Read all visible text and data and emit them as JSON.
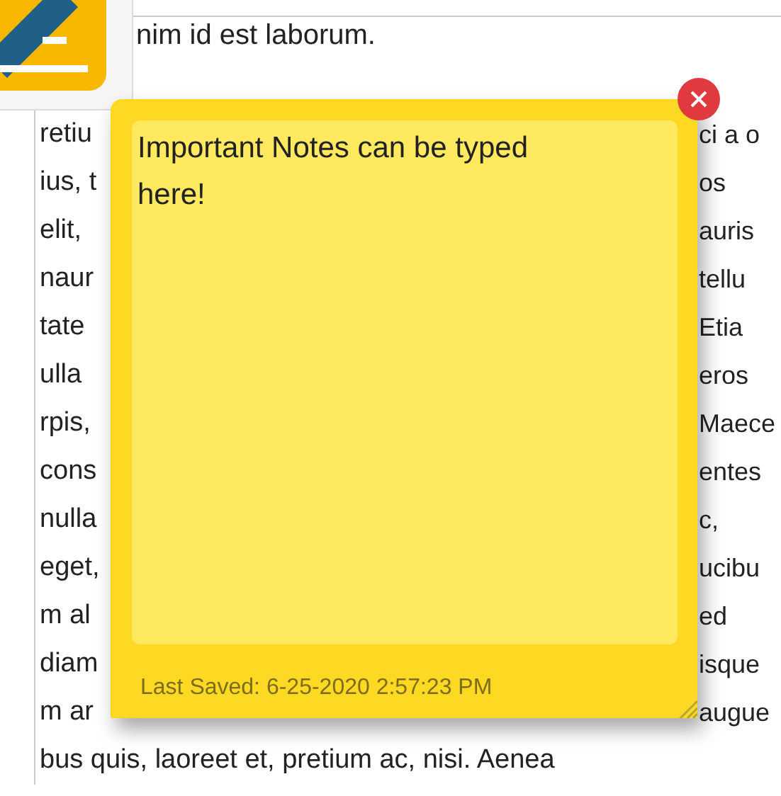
{
  "document": {
    "first_line": "nim id est laborum.",
    "lines": [
      {
        "left": "retiu",
        "right": "ci a o"
      },
      {
        "left": "ius, t",
        "right": "os"
      },
      {
        "left": "elit,",
        "right": "auris"
      },
      {
        "left": "naur",
        "right": "tellu"
      },
      {
        "left": "tate",
        "right": "Etia"
      },
      {
        "left": "ulla",
        "right": "eros"
      },
      {
        "left": "rpis,",
        "right": "Maece"
      },
      {
        "left": "cons",
        "right": "entes"
      },
      {
        "left": "nulla",
        "right": "c,"
      },
      {
        "left": "eget,",
        "right": "ucibu"
      },
      {
        "left": "m al",
        "right": "ed"
      },
      {
        "left": "diam",
        "right": "isque"
      },
      {
        "left": "m ar",
        "right": "augue"
      }
    ],
    "last_line": "bus quis, laoreet et, pretium ac, nisi. Aenea"
  },
  "sticky_note": {
    "text": "Important Notes can be typed here!",
    "last_saved": "Last Saved: 6-25-2020 2:57:23 PM"
  }
}
